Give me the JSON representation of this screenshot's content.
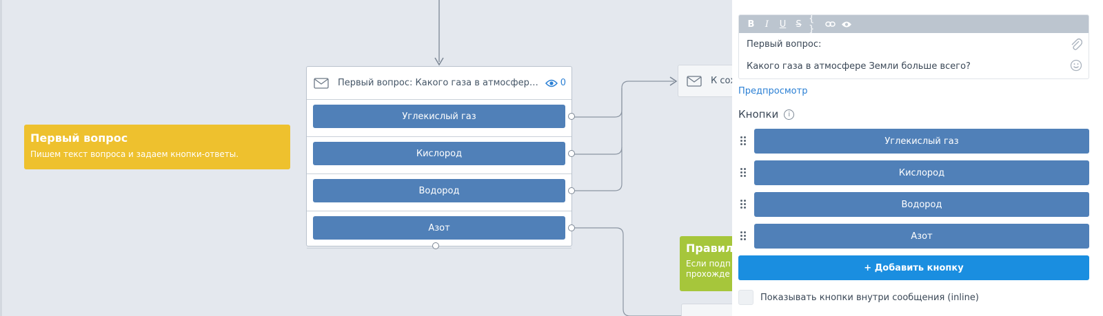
{
  "canvas": {
    "note_question": {
      "title": "Первый вопрос",
      "description": "Пишем текст вопроса и задаем кнопки-ответы."
    },
    "message_node": {
      "title": "Первый вопрос: Какого газа в атмосфере З...",
      "views_count": "0",
      "buttons": [
        "Углекислый газ",
        "Кислород",
        "Водород",
        "Азот"
      ]
    },
    "next_node": {
      "label": "К сох"
    },
    "note_rules": {
      "title": "Правил",
      "description_line1": "Если подп",
      "description_line2": "прохожде"
    }
  },
  "panel": {
    "editor": {
      "line1": "Первый вопрос:",
      "line2": "Какого газа в атмосфере Земли больше всего?",
      "toolbar": [
        "B",
        "I",
        "U",
        "S",
        "{ }",
        "link",
        "eye"
      ]
    },
    "preview_link": "Предпросмотр",
    "buttons_header": "Кнопки",
    "buttons": [
      "Углекислый газ",
      "Кислород",
      "Водород",
      "Азот"
    ],
    "add_button": "+ Добавить кнопку",
    "inline_checkbox": {
      "label": "Показывать кнопки внутри сообщения (inline)",
      "checked": false
    }
  },
  "colors": {
    "canvas_bg": "#e4e8ee",
    "button_blue": "#5080b8",
    "accent_blue": "#1a8ee0",
    "note_yellow": "#eec12e",
    "note_green": "#a6c63b"
  }
}
